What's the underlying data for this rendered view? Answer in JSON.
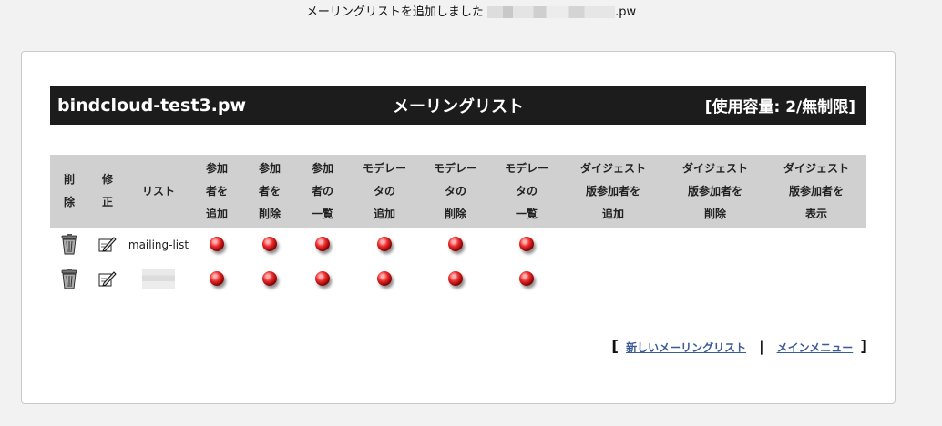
{
  "notice": {
    "prefix": "メーリングリストを追加しました",
    "suffix": ".pw"
  },
  "header": {
    "domain": "bindcloud-test3.pw",
    "title": "メーリングリスト",
    "usage": "[使用容量: 2/無制限]"
  },
  "table": {
    "columns": [
      [
        "削",
        "除"
      ],
      [
        "修",
        "正"
      ],
      [
        "リスト"
      ],
      [
        "参加",
        "者を",
        "追加"
      ],
      [
        "参加",
        "者を",
        "削除"
      ],
      [
        "参加",
        "者の",
        "一覧"
      ],
      [
        "モデレー",
        "タの",
        "追加"
      ],
      [
        "モデレー",
        "タの",
        "削除"
      ],
      [
        "モデレー",
        "タの",
        "一覧"
      ],
      [
        "ダイジェスト",
        "版参加者を",
        "追加"
      ],
      [
        "ダイジェスト",
        "版参加者を",
        "削除"
      ],
      [
        "ダイジェスト",
        "版参加者を",
        "表示"
      ]
    ],
    "rows": [
      {
        "name": "mailing-list"
      }
    ],
    "icons": {
      "delete": "trash-icon",
      "edit": "edit-pencil-icon",
      "action": "red-ball-icon"
    }
  },
  "footer": {
    "new_list": "新しいメーリングリスト",
    "main_menu": "メインメニュー",
    "open_bracket": "[",
    "close_bracket": "]",
    "separator": "|"
  },
  "colors": {
    "header_bg": "#1c1c1c",
    "table_header_bg": "#d0d0d0",
    "link": "#3a5a98",
    "dot": "#f03030"
  }
}
